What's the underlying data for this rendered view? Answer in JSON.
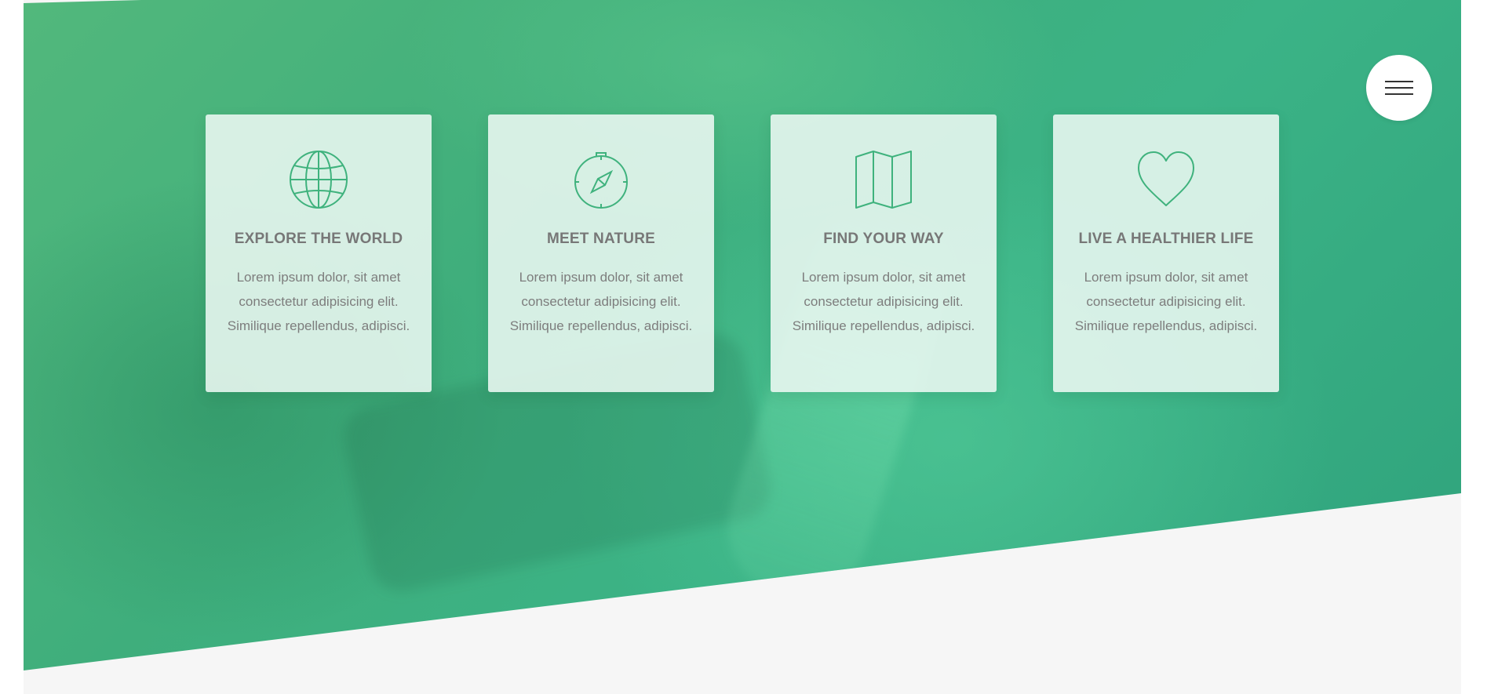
{
  "theme": {
    "accent": "#3fb27d",
    "card_background": "#e9f6ef",
    "page_background": "#f6f6f6",
    "title_color": "#777777"
  },
  "menu": {
    "icon": "hamburger-menu-icon"
  },
  "features": [
    {
      "icon": "globe-icon",
      "title": "EXPLORE THE WORLD",
      "text": "Lorem ipsum dolor, sit amet consectetur adipisicing elit. Similique repellendus, adipisci."
    },
    {
      "icon": "compass-icon",
      "title": "MEET NATURE",
      "text": "Lorem ipsum dolor, sit amet consectetur adipisicing elit. Similique repellendus, adipisci."
    },
    {
      "icon": "map-icon",
      "title": "FIND YOUR WAY",
      "text": "Lorem ipsum dolor, sit amet consectetur adipisicing elit. Similique repellendus, adipisci."
    },
    {
      "icon": "heart-icon",
      "title": "LIVE A HEALTHIER LIFE",
      "text": "Lorem ipsum dolor, sit amet consectetur adipisicing elit. Similique repellendus, adipisci."
    }
  ]
}
